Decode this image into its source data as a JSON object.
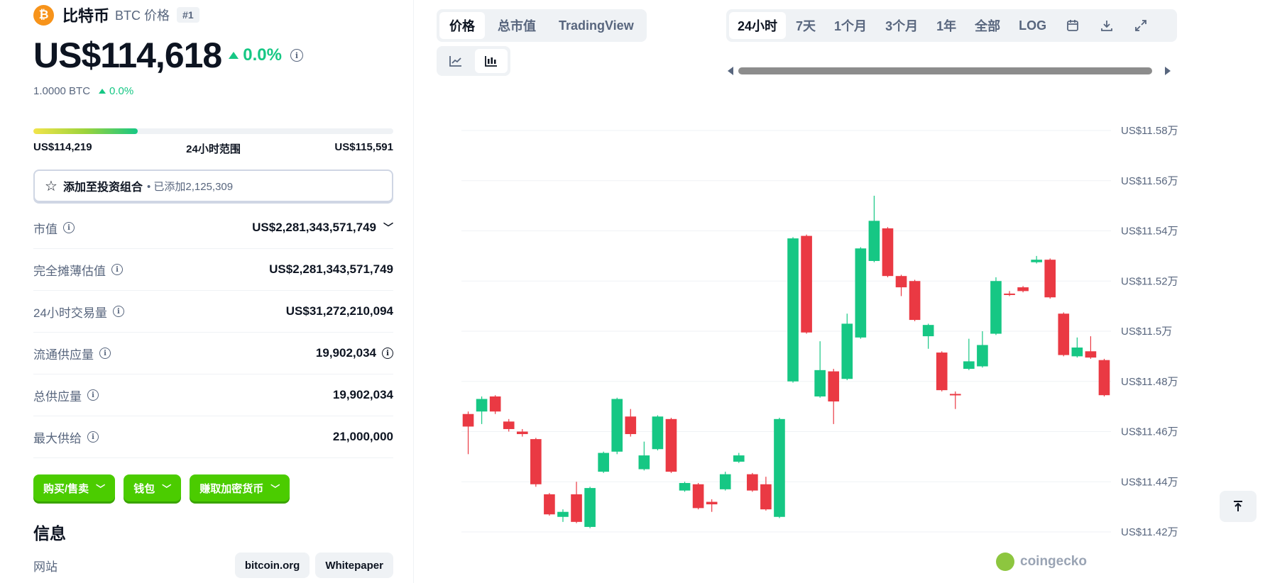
{
  "coin": {
    "name": "比特币",
    "symbol_label": "BTC 价格",
    "rank": "#1",
    "price": "US$114,618",
    "change_pct": "0.0%",
    "btc_value": "1.0000 BTC",
    "btc_change": "0.0%",
    "range_low": "US$114,219",
    "range_label": "24小时范围",
    "range_high": "US$115,591",
    "range_position": 0.29
  },
  "portfolio": {
    "label": "添加至投资组合",
    "added": "• 已添加2,125,309"
  },
  "stats": [
    {
      "label": "市值",
      "value": "US$2,281,343,571,749"
    },
    {
      "label": "完全摊薄估值",
      "value": "US$2,281,343,571,749"
    },
    {
      "label": "24小时交易量",
      "value": "US$31,272,210,094"
    },
    {
      "label": "流通供应量",
      "value": "19,902,034"
    },
    {
      "label": "总供应量",
      "value": "19,902,034"
    },
    {
      "label": "最大供给",
      "value": "21,000,000"
    }
  ],
  "actions": {
    "buy": "购买/售卖",
    "wallet": "钱包",
    "earn": "赚取加密货币"
  },
  "info": {
    "title": "信息",
    "website_label": "网站",
    "links": [
      "bitcoin.org",
      "Whitepaper"
    ]
  },
  "chart_tabs": [
    "价格",
    "总市值",
    "TradingView"
  ],
  "time_tabs": [
    "24小时",
    "7天",
    "1个月",
    "3个月",
    "1年",
    "全部",
    "LOG"
  ],
  "brand": "coingecko",
  "colors": {
    "up": "#16c784",
    "down": "#ea3943",
    "accent": "#4bcc00"
  },
  "chart_data": {
    "type": "candlestick",
    "ylim": [
      114200,
      115800
    ],
    "yticks": [
      "US$11.58万",
      "US$11.56万",
      "US$11.54万",
      "US$11.52万",
      "US$11.5万",
      "US$11.48万",
      "US$11.46万",
      "US$11.44万",
      "US$11.42万"
    ],
    "ytick_values": [
      115800,
      115600,
      115400,
      115200,
      115000,
      114800,
      114600,
      114400,
      114200
    ],
    "candles": [
      {
        "o": 114670,
        "c": 114620,
        "h": 114680,
        "l": 114510
      },
      {
        "o": 114680,
        "c": 114730,
        "h": 114740,
        "l": 114630
      },
      {
        "o": 114740,
        "c": 114680,
        "h": 114745,
        "l": 114670
      },
      {
        "o": 114640,
        "c": 114610,
        "h": 114650,
        "l": 114600
      },
      {
        "o": 114600,
        "c": 114590,
        "h": 114610,
        "l": 114580
      },
      {
        "o": 114570,
        "c": 114390,
        "h": 114575,
        "l": 114380
      },
      {
        "o": 114350,
        "c": 114270,
        "h": 114355,
        "l": 114265
      },
      {
        "o": 114260,
        "c": 114280,
        "h": 114290,
        "l": 114240
      },
      {
        "o": 114350,
        "c": 114240,
        "h": 114400,
        "l": 114235
      },
      {
        "o": 114220,
        "c": 114375,
        "h": 114380,
        "l": 114215
      },
      {
        "o": 114440,
        "c": 114515,
        "h": 114520,
        "l": 114435
      },
      {
        "o": 114520,
        "c": 114730,
        "h": 114735,
        "l": 114510
      },
      {
        "o": 114660,
        "c": 114590,
        "h": 114690,
        "l": 114580
      },
      {
        "o": 114450,
        "c": 114505,
        "h": 114560,
        "l": 114445
      },
      {
        "o": 114530,
        "c": 114660,
        "h": 114665,
        "l": 114525
      },
      {
        "o": 114650,
        "c": 114440,
        "h": 114655,
        "l": 114435
      },
      {
        "o": 114365,
        "c": 114395,
        "h": 114400,
        "l": 114360
      },
      {
        "o": 114390,
        "c": 114295,
        "h": 114395,
        "l": 114290
      },
      {
        "o": 114320,
        "c": 114310,
        "h": 114330,
        "l": 114280
      },
      {
        "o": 114370,
        "c": 114430,
        "h": 114440,
        "l": 114365
      },
      {
        "o": 114480,
        "c": 114505,
        "h": 114515,
        "l": 114475
      },
      {
        "o": 114430,
        "c": 114365,
        "h": 114435,
        "l": 114360
      },
      {
        "o": 114390,
        "c": 114290,
        "h": 114420,
        "l": 114285
      },
      {
        "o": 114260,
        "c": 114650,
        "h": 114655,
        "l": 114255
      },
      {
        "o": 114800,
        "c": 115370,
        "h": 115375,
        "l": 114795
      },
      {
        "o": 115380,
        "c": 114995,
        "h": 115385,
        "l": 114990
      },
      {
        "o": 114740,
        "c": 114845,
        "h": 114960,
        "l": 114735
      },
      {
        "o": 114840,
        "c": 114720,
        "h": 114850,
        "l": 114630
      },
      {
        "o": 114810,
        "c": 115030,
        "h": 115070,
        "l": 114805
      },
      {
        "o": 114975,
        "c": 115330,
        "h": 115335,
        "l": 114970
      },
      {
        "o": 115280,
        "c": 115440,
        "h": 115540,
        "l": 115275
      },
      {
        "o": 115410,
        "c": 115220,
        "h": 115415,
        "l": 115215
      },
      {
        "o": 115220,
        "c": 115175,
        "h": 115225,
        "l": 115140
      },
      {
        "o": 115200,
        "c": 115045,
        "h": 115205,
        "l": 115040
      },
      {
        "o": 114980,
        "c": 115025,
        "h": 115030,
        "l": 114930
      },
      {
        "o": 114915,
        "c": 114765,
        "h": 114920,
        "l": 114760
      },
      {
        "o": 114750,
        "c": 114745,
        "h": 114760,
        "l": 114690
      },
      {
        "o": 114850,
        "c": 114880,
        "h": 114970,
        "l": 114845
      },
      {
        "o": 114860,
        "c": 114945,
        "h": 115000,
        "l": 114855
      },
      {
        "o": 114990,
        "c": 115200,
        "h": 115215,
        "l": 114985
      },
      {
        "o": 115150,
        "c": 115145,
        "h": 115160,
        "l": 115140
      },
      {
        "o": 115175,
        "c": 115160,
        "h": 115180,
        "l": 115155
      },
      {
        "o": 115275,
        "c": 115285,
        "h": 115300,
        "l": 115270
      },
      {
        "o": 115285,
        "c": 115135,
        "h": 115290,
        "l": 115130
      },
      {
        "o": 115070,
        "c": 114905,
        "h": 115075,
        "l": 114900
      },
      {
        "o": 114900,
        "c": 114935,
        "h": 114975,
        "l": 114895
      },
      {
        "o": 114920,
        "c": 114895,
        "h": 114980,
        "l": 114890
      },
      {
        "o": 114885,
        "c": 114745,
        "h": 114890,
        "l": 114740
      }
    ]
  }
}
